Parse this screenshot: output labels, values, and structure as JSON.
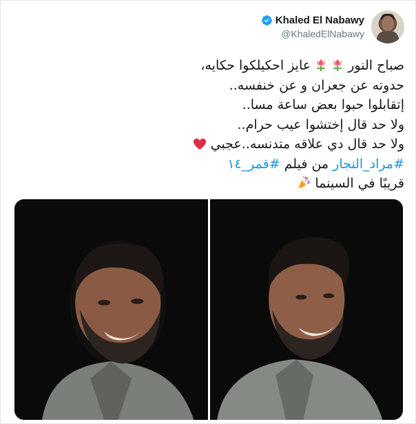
{
  "author": {
    "name": "Khaled El Nabawy",
    "handle": "@KhaledElNabawy",
    "verified": true,
    "avatar_icon": "profile-photo"
  },
  "tweet": {
    "line1_start": "صباح النور ",
    "line1_mid": "عايز احكيلكوا حكايه،",
    "line2": "حدوته عن جعران و عن خنفسه..",
    "line3": "إتقابلوا حبوا بعض ساعة مسا..",
    "line4": "ولا حد قال إختشوا عيب حرام..",
    "line5": "ولا حد قال دي علاقه متدنسه..عجبي",
    "hashtag1": "#مراد_النجار",
    "line6_mid": " من فيلم ",
    "hashtag2": "#قمر_١٤",
    "line7": "قريبًا في السينما"
  },
  "colors": {
    "link": "#1b95e0",
    "text": "#14171a",
    "secondary": "#657786",
    "verified": "#1da1f2",
    "border": "#e1e8ed"
  },
  "media": {
    "count": 2,
    "photos": [
      "portrait-smiling-profile",
      "portrait-smiling-three-quarter"
    ]
  }
}
